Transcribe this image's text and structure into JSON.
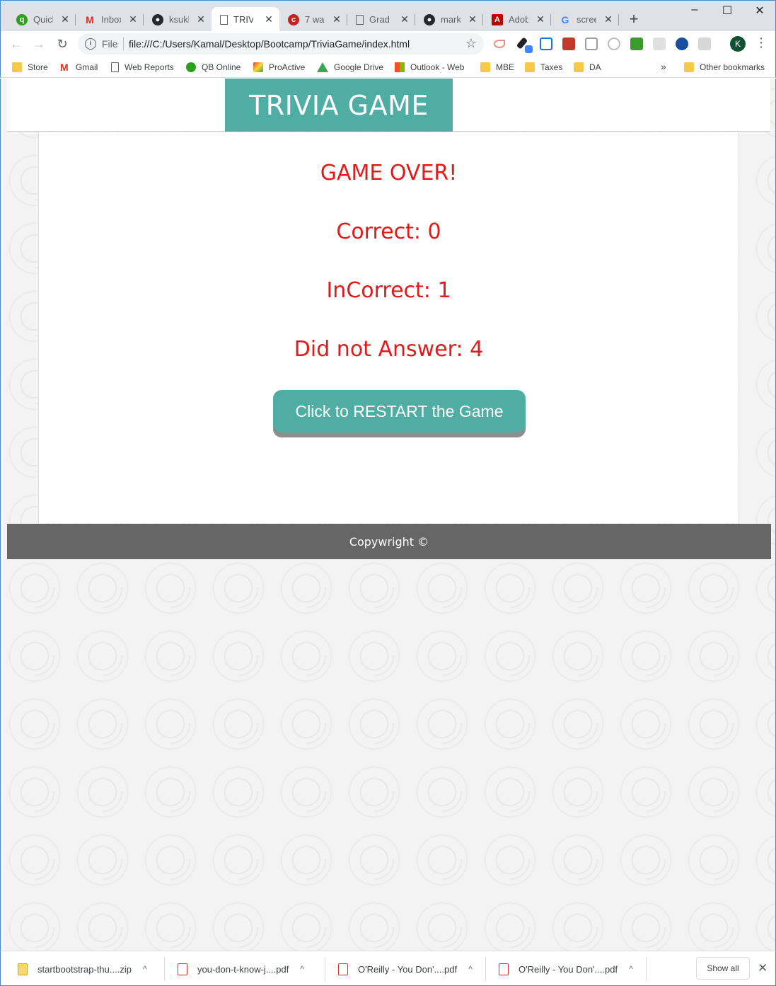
{
  "browser": {
    "tabs": [
      {
        "label": "Quick",
        "icon": "quickbooks-icon",
        "active": false
      },
      {
        "label": "Inbox",
        "icon": "gmail-icon",
        "active": false
      },
      {
        "label": "ksukh",
        "icon": "github-icon",
        "active": false
      },
      {
        "label": "TRIVIA",
        "icon": "page-icon",
        "active": true
      },
      {
        "label": "7 way",
        "icon": "site-icon",
        "active": false
      },
      {
        "label": "Grade",
        "icon": "page-icon",
        "active": false
      },
      {
        "label": "markc",
        "icon": "github-icon",
        "active": false
      },
      {
        "label": "Adobe",
        "icon": "adobe-icon",
        "active": false
      },
      {
        "label": "screen",
        "icon": "google-icon",
        "active": false
      }
    ],
    "new_tab": "+",
    "window_controls": {
      "minimize": "–",
      "maximize": "☐",
      "close": "✕"
    },
    "omnibox": {
      "scheme_label": "File",
      "url": "file:///C:/Users/Kamal/Desktop/Bootcamp/TriviaGame/index.html"
    },
    "profile_initial": "K",
    "bookmarks": [
      {
        "label": "Store",
        "icon": "folder-icon"
      },
      {
        "label": "Gmail",
        "icon": "gmail-icon"
      },
      {
        "label": "Web Reports",
        "icon": "page-icon"
      },
      {
        "label": "QB Online",
        "icon": "quickbooks-icon"
      },
      {
        "label": "ProActive",
        "icon": "proactive-icon"
      },
      {
        "label": "Google Drive",
        "icon": "drive-icon"
      },
      {
        "label": "Outlook - Web",
        "icon": "outlook-icon"
      },
      {
        "label": "MBE",
        "icon": "folder-icon"
      },
      {
        "label": "Taxes",
        "icon": "folder-icon"
      },
      {
        "label": "DA",
        "icon": "folder-icon"
      }
    ],
    "bookmarks_more": "»",
    "other_bookmarks": "Other bookmarks"
  },
  "page": {
    "title": "TRIVIA GAME",
    "game_over": "GAME OVER!",
    "correct": "Correct: 0",
    "incorrect": "InCorrect: 1",
    "unanswered": "Did not Answer: 4",
    "restart_label": "Click to RESTART the Game",
    "footer": "Copywright ©",
    "colors": {
      "accent": "#4fada4",
      "result_text": "#e11a1a",
      "footer_bg": "#666666"
    }
  },
  "downloads": {
    "items": [
      {
        "name": "startbootstrap-thu....zip",
        "icon": "zip-file-icon"
      },
      {
        "name": "you-don-t-know-j....pdf",
        "icon": "pdf-file-icon"
      },
      {
        "name": "O'Reilly - You Don'....pdf",
        "icon": "pdf-file-icon"
      },
      {
        "name": "O'Reilly - You Don'....pdf",
        "icon": "pdf-file-icon"
      }
    ],
    "show_all": "Show all"
  }
}
